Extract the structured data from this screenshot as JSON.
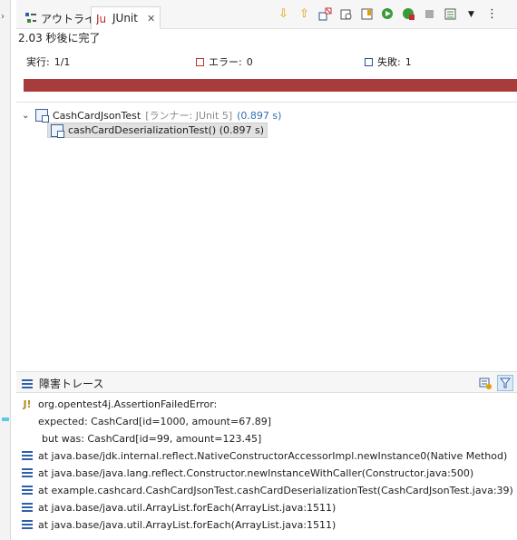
{
  "tabs": {
    "outline_label": "アウトライン",
    "junit_label": "JUnit"
  },
  "icons": {
    "outline": "outline-icon",
    "junit": "junit-icon",
    "close": "close-icon"
  },
  "status": {
    "text": "2.03 秒後に完了"
  },
  "counters": {
    "runs_label": "実行:",
    "runs_value": "1/1",
    "errors_label": "エラー:",
    "errors_value": "0",
    "failures_label": "失敗:",
    "failures_value": "1"
  },
  "progress": {
    "status": "failed",
    "fraction": 1.0,
    "color": "#a83c3c"
  },
  "tree": {
    "root_name": "CashCardJsonTest",
    "root_runner": "[ランナー: JUnit 5]",
    "root_time": "(0.897 s)",
    "child_name": "cashCardDeserializationTest() (0.897 s)"
  },
  "trace": {
    "title": "障害トレース",
    "lines": [
      "org.opentest4j.AssertionFailedError:",
      "expected: CashCard[id=1000, amount=67.89]",
      "but was: CashCard[id=99, amount=123.45]",
      "at java.base/jdk.internal.reflect.NativeConstructorAccessorImpl.newInstance0(Native Method)",
      "at java.base/java.lang.reflect.Constructor.newInstanceWithCaller(Constructor.java:500)",
      "at example.cashcard.CashCardJsonTest.cashCardDeserializationTest(CashCardJsonTest.java:39)",
      "at java.base/java.util.ArrayList.forEach(ArrayList.java:1511)",
      "at java.base/java.util.ArrayList.forEach(ArrayList.java:1511)"
    ]
  },
  "colors": {
    "failure_bar": "#a83c3c",
    "time_text": "#2f6fb0",
    "accent_blue": "#2f5fa8"
  }
}
